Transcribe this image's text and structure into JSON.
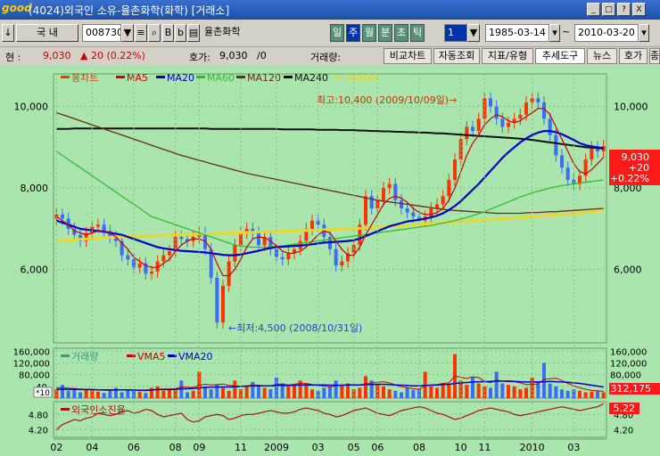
{
  "window": {
    "logo": "good",
    "title": "(4024)외국인 소유-율촌화학(화학) [거래소]",
    "buttons": [
      "_",
      "□",
      "?",
      "X"
    ]
  },
  "toolbar": {
    "market_arrow": "↓",
    "market": "국  내",
    "code": "008730",
    "icon_a": "B",
    "icon_b": "b",
    "name": "율촌화학",
    "periods": [
      "일",
      "주",
      "월",
      "분",
      "초",
      "틱"
    ],
    "selected_period": "주",
    "period_count": "1",
    "start_date": "1985-03-14",
    "tilde": "~",
    "end_date": "2010-03-20"
  },
  "info": {
    "price_label": "현 :",
    "price": "9,030",
    "change": "▲ 20 (0.22%)",
    "ask_label": "호가:",
    "ask": "9,030",
    "ask_sep": "/0",
    "volume_label": "거래량:",
    "tabs": [
      "비교차트",
      "자동조회",
      "지표/유형",
      "추세도구",
      "뉴스",
      "호가",
      "종"
    ],
    "selected_tab": "추세도구"
  },
  "colors": {
    "bg": "#a9e5ad",
    "up": "#ff3300",
    "down": "#3a6cff",
    "ma5": "#cc0000",
    "ma20": "#0000cc",
    "ma60": "#33bb33",
    "ma120": "#6b2a1a",
    "ma240": "#111111",
    "ma480": "#e8d830"
  },
  "chart_data": [
    {
      "type": "candlestick",
      "legend": [
        "봉차트",
        "MA5",
        "MA20",
        "MA60",
        "MA120",
        "MA240",
        "MA480"
      ],
      "legend_placement": "top-left",
      "x_ticks": [
        "02",
        "04",
        "06",
        "08",
        "09",
        "11",
        "2009",
        "03",
        "05",
        "06",
        "08",
        "10",
        "11",
        "2010",
        "03"
      ],
      "ylim": [
        4200,
        10800
      ],
      "y_ticks_left": [
        "10,000",
        "8,000",
        "6,000"
      ],
      "y_ticks_right": [
        "10,000",
        "8,000",
        "6,000"
      ],
      "grid": true,
      "annotations": {
        "high": "최고:10,400 (2009/10/09일)→",
        "low": "←최저:4,500 (2008/10/31일)"
      },
      "last_box": [
        "9,030",
        "+20",
        "+0.22%"
      ],
      "closes": [
        7350,
        7250,
        7000,
        6850,
        6700,
        6900,
        7050,
        7100,
        6950,
        6800,
        6700,
        6350,
        6250,
        6050,
        6150,
        5900,
        5950,
        6200,
        6350,
        6450,
        6800,
        6750,
        6700,
        6800,
        6900,
        6500,
        5800,
        4700,
        5600,
        6200,
        6600,
        6900,
        7000,
        6900,
        6600,
        6800,
        6500,
        6300,
        6250,
        6400,
        6500,
        6700,
        7000,
        7200,
        7100,
        6800,
        6500,
        6100,
        6200,
        6400,
        6600,
        7100,
        7800,
        7500,
        7700,
        8000,
        8100,
        7700,
        7500,
        7400,
        7300,
        7200,
        7300,
        7500,
        7600,
        7800,
        8200,
        8700,
        9200,
        9500,
        9400,
        9700,
        10200,
        10000,
        9700,
        9500,
        9600,
        9700,
        9800,
        10100,
        10200,
        10100,
        9700,
        9300,
        8800,
        8500,
        8200,
        8100,
        8300,
        8700,
        9000,
        8900,
        9030
      ],
      "ma5": [
        7300,
        7200,
        7100,
        6950,
        6900,
        6850,
        6900,
        6950,
        6950,
        6900,
        6800,
        6650,
        6500,
        6300,
        6200,
        6100,
        6050,
        6050,
        6150,
        6250,
        6450,
        6600,
        6700,
        6750,
        6750,
        6700,
        6500,
        6150,
        5850,
        5850,
        6000,
        6250,
        6550,
        6750,
        6800,
        6780,
        6700,
        6580,
        6450,
        6400,
        6400,
        6450,
        6550,
        6700,
        6850,
        6950,
        6900,
        6700,
        6500,
        6350,
        6350,
        6550,
        6850,
        7100,
        7350,
        7600,
        7750,
        7800,
        7750,
        7650,
        7500,
        7400,
        7350,
        7350,
        7400,
        7500,
        7700,
        8000,
        8400,
        8800,
        9100,
        9300,
        9550,
        9700,
        9800,
        9750,
        9650,
        9600,
        9650,
        9750,
        9850,
        9950,
        9950,
        9800,
        9500,
        9200,
        8900,
        8600,
        8400,
        8350,
        8450,
        8600,
        8750
      ],
      "ma20": [
        7200,
        7150,
        7100,
        7050,
        7000,
        6980,
        6960,
        6950,
        6930,
        6900,
        6880,
        6850,
        6800,
        6750,
        6700,
        6650,
        6600,
        6550,
        6520,
        6500,
        6480,
        6460,
        6450,
        6440,
        6430,
        6420,
        6400,
        6380,
        6360,
        6350,
        6350,
        6370,
        6400,
        6430,
        6460,
        6500,
        6530,
        6550,
        6560,
        6570,
        6580,
        6590,
        6600,
        6620,
        6640,
        6660,
        6670,
        6680,
        6690,
        6700,
        6720,
        6760,
        6820,
        6880,
        6940,
        7000,
        7060,
        7100,
        7140,
        7180,
        7200,
        7220,
        7250,
        7280,
        7320,
        7380,
        7460,
        7560,
        7680,
        7820,
        7960,
        8100,
        8260,
        8420,
        8580,
        8740,
        8880,
        9000,
        9120,
        9220,
        9300,
        9360,
        9400,
        9400,
        9370,
        9320,
        9250,
        9180,
        9100,
        9050,
        9020,
        9000,
        8980
      ],
      "ma60": [
        8900,
        8800,
        8700,
        8600,
        8500,
        8400,
        8300,
        8200,
        8100,
        8000,
        7900,
        7800,
        7700,
        7600,
        7500,
        7400,
        7300,
        7250,
        7200,
        7150,
        7100,
        7050,
        7000,
        6950,
        6900,
        6850,
        6800,
        6750,
        6700,
        6650,
        6600,
        6580,
        6560,
        6550,
        6550,
        6550,
        6560,
        6570,
        6580,
        6600,
        6620,
        6640,
        6660,
        6680,
        6700,
        6720,
        6740,
        6760,
        6780,
        6800,
        6820,
        6840,
        6860,
        6880,
        6900,
        6920,
        6940,
        6960,
        6980,
        7000,
        7020,
        7040,
        7060,
        7080,
        7110,
        7140,
        7170,
        7200,
        7240,
        7280,
        7320,
        7370,
        7420,
        7480,
        7540,
        7600,
        7660,
        7720,
        7780,
        7830,
        7880,
        7920,
        7960,
        8000,
        8030,
        8060,
        8080,
        8100,
        8120,
        8140,
        8160,
        8180,
        8200
      ],
      "ma120": [
        9850,
        9800,
        9750,
        9700,
        9650,
        9600,
        9550,
        9500,
        9450,
        9400,
        9350,
        9300,
        9250,
        9200,
        9150,
        9100,
        9050,
        9000,
        8950,
        8900,
        8850,
        8800,
        8760,
        8720,
        8680,
        8640,
        8600,
        8560,
        8520,
        8480,
        8440,
        8400,
        8360,
        8330,
        8300,
        8270,
        8240,
        8210,
        8180,
        8150,
        8120,
        8090,
        8060,
        8030,
        8000,
        7970,
        7940,
        7910,
        7880,
        7850,
        7820,
        7790,
        7760,
        7730,
        7700,
        7680,
        7660,
        7640,
        7620,
        7600,
        7580,
        7560,
        7540,
        7520,
        7500,
        7480,
        7460,
        7450,
        7440,
        7430,
        7420,
        7410,
        7400,
        7390,
        7380,
        7380,
        7380,
        7380,
        7380,
        7390,
        7400,
        7400,
        7410,
        7420,
        7420,
        7430,
        7440,
        7450,
        7460,
        7470,
        7480,
        7490,
        7500
      ],
      "ma240": [
        9450,
        9450,
        9450,
        9460,
        9460,
        9460,
        9460,
        9460,
        9460,
        9460,
        9460,
        9460,
        9460,
        9460,
        9460,
        9460,
        9460,
        9460,
        9460,
        9460,
        9460,
        9460,
        9460,
        9460,
        9460,
        9460,
        9450,
        9450,
        9450,
        9450,
        9450,
        9450,
        9450,
        9450,
        9450,
        9450,
        9450,
        9450,
        9440,
        9440,
        9440,
        9440,
        9440,
        9440,
        9430,
        9430,
        9430,
        9430,
        9420,
        9420,
        9420,
        9410,
        9410,
        9400,
        9400,
        9390,
        9390,
        9380,
        9380,
        9370,
        9370,
        9360,
        9360,
        9350,
        9340,
        9340,
        9330,
        9320,
        9310,
        9300,
        9290,
        9280,
        9270,
        9260,
        9250,
        9240,
        9230,
        9220,
        9210,
        9200,
        9180,
        9160,
        9140,
        9120,
        9100,
        9080,
        9060,
        9040,
        9020,
        9000,
        8990,
        8980,
        8970
      ],
      "ma480": [
        6700,
        6710,
        6720,
        6730,
        6740,
        6750,
        6760,
        6770,
        6780,
        6790,
        6800,
        6805,
        6810,
        6815,
        6820,
        6825,
        6830,
        6835,
        6840,
        6845,
        6850,
        6855,
        6860,
        6865,
        6870,
        6875,
        6880,
        6885,
        6890,
        6895,
        6900,
        6905,
        6910,
        6915,
        6920,
        6925,
        6930,
        6935,
        6940,
        6945,
        6950,
        6955,
        6960,
        6965,
        6970,
        6975,
        6980,
        6985,
        6990,
        6995,
        7000,
        7010,
        7020,
        7030,
        7040,
        7050,
        7060,
        7070,
        7080,
        7090,
        7100,
        7110,
        7120,
        7130,
        7140,
        7150,
        7160,
        7170,
        7180,
        7190,
        7200,
        7210,
        7220,
        7230,
        7240,
        7250,
        7260,
        7270,
        7280,
        7290,
        7300,
        7310,
        7320,
        7330,
        7340,
        7350,
        7360,
        7370,
        7380,
        7400,
        7420,
        7440,
        7460
      ]
    },
    {
      "type": "bar",
      "legend": [
        "거래량",
        "VMA5",
        "VMA20"
      ],
      "y_ticks_left": [
        "160,000",
        "120,000",
        "80,000",
        "40,"
      ],
      "y_ticks_right": [
        "160,000",
        "120,000",
        "80,000"
      ],
      "unit_label": "*10",
      "last_value": "312,175",
      "ylim": [
        0,
        170000
      ],
      "values": [
        30000,
        45000,
        25000,
        35000,
        20000,
        28000,
        30000,
        22000,
        18000,
        25000,
        35000,
        20000,
        28000,
        30000,
        22000,
        18000,
        35000,
        40000,
        25000,
        30000,
        28000,
        60000,
        20000,
        25000,
        90000,
        40000,
        30000,
        45000,
        35000,
        25000,
        60000,
        30000,
        40000,
        55000,
        45000,
        35000,
        30000,
        70000,
        50000,
        40000,
        45000,
        60000,
        50000,
        30000,
        25000,
        35000,
        40000,
        60000,
        45000,
        50000,
        30000,
        35000,
        75000,
        60000,
        45000,
        40000,
        30000,
        25000,
        20000,
        35000,
        28000,
        30000,
        90000,
        40000,
        35000,
        50000,
        45000,
        150000,
        60000,
        45000,
        70000,
        50000,
        40000,
        35000,
        90000,
        50000,
        45000,
        40000,
        30000,
        35000,
        70000,
        55000,
        120000,
        50000,
        40000,
        30000,
        25000,
        30000,
        25000,
        20000,
        22000,
        25000,
        20000
      ],
      "vma5": [
        35000,
        35000,
        34000,
        32000,
        31000,
        30000,
        29000,
        28000,
        27000,
        26000,
        27000,
        28000,
        28000,
        27000,
        26000,
        25000,
        27000,
        30000,
        31000,
        31000,
        32000,
        38000,
        37000,
        36000,
        44000,
        47000,
        45000,
        46000,
        48000,
        43000,
        42000,
        40000,
        41000,
        45000,
        44000,
        42000,
        41000,
        47000,
        48000,
        45000,
        47000,
        51000,
        50000,
        46000,
        43000,
        41000,
        38000,
        42000,
        43000,
        46000,
        45000,
        44000,
        49000,
        52000,
        54000,
        56000,
        52000,
        45000,
        39000,
        36000,
        32000,
        30000,
        42000,
        45000,
        46000,
        50000,
        52000,
        76000,
        71000,
        67000,
        72000,
        70000,
        57000,
        52000,
        61000,
        58000,
        56000,
        56000,
        52000,
        46000,
        47000,
        48000,
        64000,
        66000,
        68000,
        60000,
        50000,
        42000,
        35000,
        30000,
        26000,
        25000,
        23000
      ],
      "vma20": [
        30000,
        30000,
        30000,
        30000,
        29000,
        29000,
        29000,
        28000,
        28000,
        28000,
        28000,
        28000,
        28000,
        27000,
        27000,
        27000,
        28000,
        29000,
        29000,
        29000,
        30000,
        32000,
        32000,
        33000,
        35000,
        36000,
        37000,
        38000,
        38000,
        38000,
        39000,
        40000,
        41000,
        42000,
        42000,
        42000,
        42000,
        43000,
        43000,
        43000,
        44000,
        45000,
        45000,
        45000,
        45000,
        45000,
        44000,
        44000,
        44000,
        45000,
        45000,
        45000,
        46000,
        46000,
        47000,
        47000,
        46000,
        45000,
        44000,
        43000,
        42000,
        42000,
        43000,
        44000,
        45000,
        46000,
        47000,
        50000,
        52000,
        53000,
        55000,
        56000,
        56000,
        57000,
        58000,
        58000,
        58000,
        57000,
        56000,
        55000,
        55000,
        55000,
        56000,
        57000,
        56000,
        55000,
        54000,
        52000,
        50000,
        47000,
        44000,
        41000,
        38000
      ]
    },
    {
      "type": "line",
      "legend": [
        "외국인소진율"
      ],
      "y_ticks_left": [
        "4.80",
        "4.20"
      ],
      "y_ticks_right": [
        "4.80",
        "4.20"
      ],
      "last_value": "5.22",
      "ylim": [
        3.9,
        5.3
      ],
      "values": [
        4.2,
        4.4,
        4.5,
        4.6,
        4.55,
        4.65,
        4.7,
        4.85,
        4.8,
        4.75,
        4.8,
        4.9,
        4.95,
        4.85,
        4.9,
        5.0,
        4.95,
        4.8,
        4.7,
        4.75,
        4.8,
        4.85,
        4.6,
        4.5,
        4.55,
        4.7,
        4.75,
        4.8,
        4.75,
        4.6,
        4.65,
        4.75,
        4.8,
        4.8,
        4.85,
        4.9,
        4.95,
        4.9,
        4.85,
        4.85,
        4.9,
        5.0,
        5.05,
        5.0,
        4.95,
        4.85,
        4.8,
        4.7,
        4.75,
        4.85,
        4.95,
        5.0,
        5.05,
        4.95,
        4.85,
        4.8,
        4.75,
        4.85,
        4.95,
        5.0,
        5.05,
        5.1,
        5.05,
        4.95,
        4.85,
        4.8,
        4.7,
        4.6,
        4.65,
        4.75,
        4.85,
        4.95,
        5.0,
        5.05,
        5.0,
        4.95,
        4.9,
        4.8,
        4.75,
        4.8,
        4.85,
        4.9,
        4.95,
        5.0,
        5.05,
        5.1,
        5.05,
        5.0,
        4.95,
        5.0,
        5.05,
        5.1,
        5.22
      ]
    }
  ]
}
